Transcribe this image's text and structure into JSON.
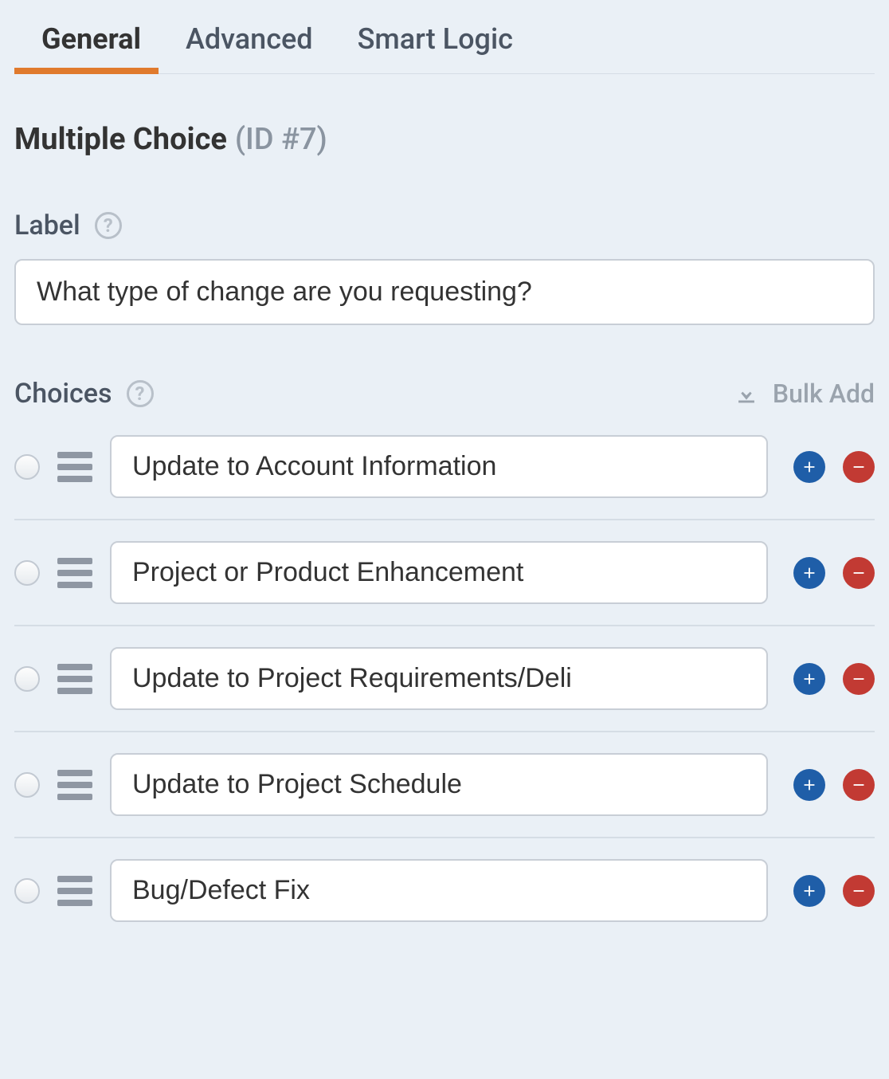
{
  "tabs": [
    {
      "label": "General",
      "active": true
    },
    {
      "label": "Advanced",
      "active": false
    },
    {
      "label": "Smart Logic",
      "active": false
    }
  ],
  "heading": {
    "title": "Multiple Choice",
    "id_text": "(ID #7)"
  },
  "label_section": {
    "label": "Label",
    "value": "What type of change are you requesting?"
  },
  "choices_section": {
    "label": "Choices",
    "bulk_add_label": "Bulk Add"
  },
  "choices": [
    {
      "value": "Update to Account Information"
    },
    {
      "value": "Project or Product Enhancement"
    },
    {
      "value": "Update to Project Requirements/Deli"
    },
    {
      "value": "Update to Project Schedule"
    },
    {
      "value": "Bug/Defect Fix"
    }
  ]
}
